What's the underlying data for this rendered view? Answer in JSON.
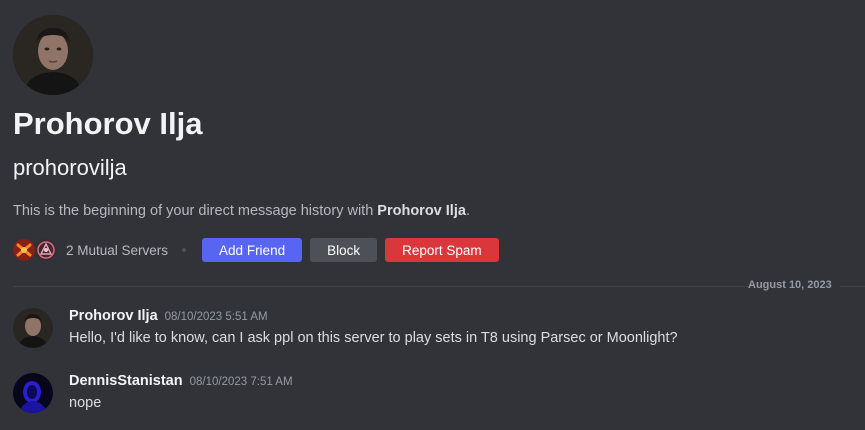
{
  "profile": {
    "display_name": "Prohorov Ilja",
    "username": "prohorovilja",
    "intro_prefix": "This is the beginning of your direct message history with ",
    "intro_name": "Prohorov Ilja",
    "intro_suffix": ".",
    "mutual_servers": "2 Mutual Servers"
  },
  "actions": {
    "add_friend": "Add Friend",
    "block": "Block",
    "report_spam": "Report Spam"
  },
  "divider": {
    "date": "August 10, 2023"
  },
  "messages": [
    {
      "author": "Prohorov Ilja",
      "timestamp": "08/10/2023 5:51 AM",
      "text": "Hello, I'd like to know, can I ask ppl on this server to play sets in T8 using Parsec or Moonlight?"
    },
    {
      "author": "DennisStanistan",
      "timestamp": "08/10/2023 7:51 AM",
      "text": "nope"
    }
  ],
  "colors": {
    "background": "#313338",
    "add_friend": "#5865f2",
    "block": "#4e5058",
    "report_spam": "#da373c"
  }
}
